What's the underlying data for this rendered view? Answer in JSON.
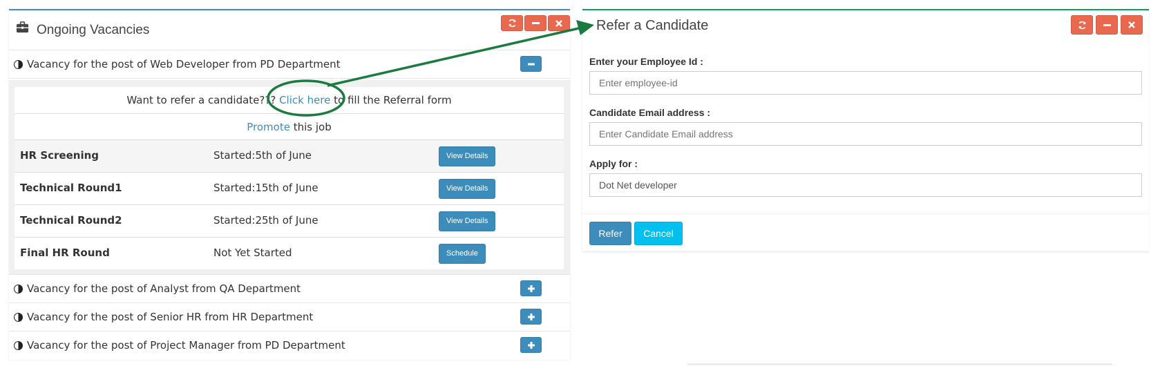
{
  "vacancies_panel": {
    "title": "Ongoing Vacancies",
    "tools": {
      "refresh_icon": "refresh-icon",
      "minimize_icon": "minus-icon",
      "close_icon": "close-icon"
    },
    "accent_color": "#3c8dbc",
    "tool_color": "#e8694f",
    "expanded_vacancy": {
      "label": "Vacancy for the post of Web Developer from PD Department",
      "toggle_icon": "minus",
      "refer_prefix": "Want to refer a candidate??? ",
      "refer_link": "Click here",
      "refer_suffix": " to fill the Referral form",
      "promote_link": "Promote",
      "promote_suffix": " this job",
      "stages": [
        {
          "name": "HR Screening",
          "status": "Started:5th of June",
          "action": "View Details"
        },
        {
          "name": "Technical Round1",
          "status": "Started:15th of June",
          "action": "View Details"
        },
        {
          "name": "Technical Round2",
          "status": "Started:25th of June",
          "action": "View Details"
        },
        {
          "name": "Final HR Round",
          "status": "Not Yet Started",
          "action": "Schedule"
        }
      ]
    },
    "collapsed_vacancies": [
      {
        "label": "Vacancy for the post of Analyst from QA Department",
        "toggle_icon": "plus"
      },
      {
        "label": "Vacancy for the post of Senior HR from HR Department",
        "toggle_icon": "plus"
      },
      {
        "label": "Vacancy for the post of Project Manager from PD Department",
        "toggle_icon": "plus"
      }
    ]
  },
  "refer_panel": {
    "title": "Refer a Candidate",
    "accent_color": "#00a65a",
    "employee_id": {
      "label": "Enter your Employee Id :",
      "placeholder": "Enter employee-id",
      "value": ""
    },
    "candidate_email": {
      "label": "Candidate Email address :",
      "placeholder": "Enter Candidate Email address",
      "value": ""
    },
    "apply_for": {
      "label": "Apply for :",
      "value": "Dot Net developer"
    },
    "refer_button": "Refer",
    "cancel_button": "Cancel"
  },
  "annotation": {
    "color": "#1a7a3f",
    "shape": "ellipse-and-arrow"
  }
}
